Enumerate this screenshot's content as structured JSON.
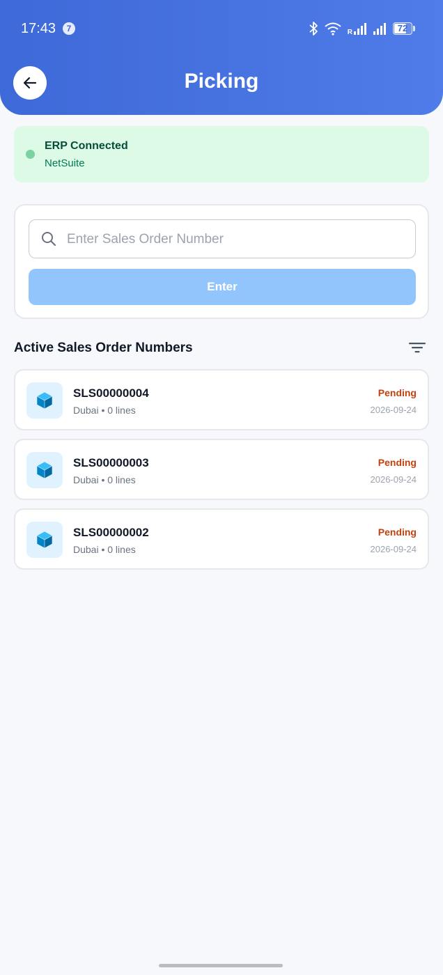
{
  "status_bar": {
    "time": "17:43",
    "notification_count": "7",
    "roaming_indicator": "R",
    "battery_level": "72",
    "battery_fraction": 0.72
  },
  "header": {
    "title": "Picking"
  },
  "erp": {
    "title": "ERP Connected",
    "subtitle": "NetSuite"
  },
  "search": {
    "placeholder": "Enter Sales Order Number",
    "value": "",
    "button_label": "Enter"
  },
  "orders_section": {
    "title": "Active Sales Order Numbers"
  },
  "orders": [
    {
      "number": "SLS00000004",
      "meta": "Dubai • 0 lines",
      "status": "Pending",
      "date": "2026-09-24"
    },
    {
      "number": "SLS00000003",
      "meta": "Dubai • 0 lines",
      "status": "Pending",
      "date": "2026-09-24"
    },
    {
      "number": "SLS00000002",
      "meta": "Dubai • 0 lines",
      "status": "Pending",
      "date": "2026-09-24"
    }
  ],
  "icons": {
    "back": "arrow-left-icon",
    "search": "search-icon",
    "filter": "filter-icon",
    "order": "box-icon",
    "bluetooth": "bluetooth-icon",
    "wifi": "wifi-icon",
    "signal": "signal-icon"
  },
  "colors": {
    "header": "#4a74e2",
    "erp_banner_bg": "#dcfae6",
    "erp_dot": "#7ad2a0",
    "enter_button": "#93c5fd",
    "status_pending": "#c2410c",
    "order_icon_bg": "#e0f2fe",
    "order_icon": "#0284c7"
  }
}
